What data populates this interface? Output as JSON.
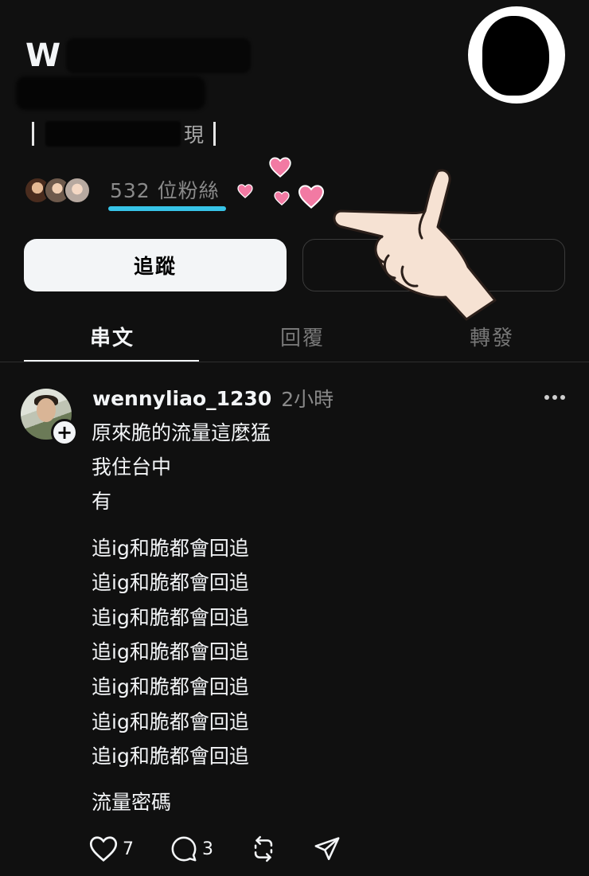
{
  "profile": {
    "name_visible": "W",
    "bio_visible_suffix": "現",
    "followers_label": "532 位粉絲"
  },
  "buttons": {
    "follow_label": "追蹤"
  },
  "tabs": [
    {
      "label": "串文",
      "active": true
    },
    {
      "label": "回覆",
      "active": false
    },
    {
      "label": "轉發",
      "active": false
    }
  ],
  "post": {
    "username": "wennyliao_1230",
    "time": "2小時",
    "lines": [
      "原來脆的流量這麼猛",
      "我住台中",
      "有",
      "追ig和脆都會回追",
      "追ig和脆都會回追",
      "追ig和脆都會回追",
      "追ig和脆都會回追",
      "追ig和脆都會回追",
      "追ig和脆都會回追",
      "追ig和脆都會回追",
      "流量密碼"
    ],
    "actions": {
      "like_count": "7",
      "comment_count": "3"
    }
  },
  "icons": {
    "like": "heart-outline-icon",
    "comment": "speech-bubble-icon",
    "repost": "repost-arrows-icon",
    "share": "paper-plane-icon",
    "more": "more-dots-icon",
    "add": "plus-badge-icon"
  },
  "colors": {
    "background": "#101010",
    "text_primary": "#f3f5f7",
    "text_secondary": "#8a8a8a",
    "accent_underline": "#37c4e8",
    "sticker_heart": "#f27aa3"
  }
}
